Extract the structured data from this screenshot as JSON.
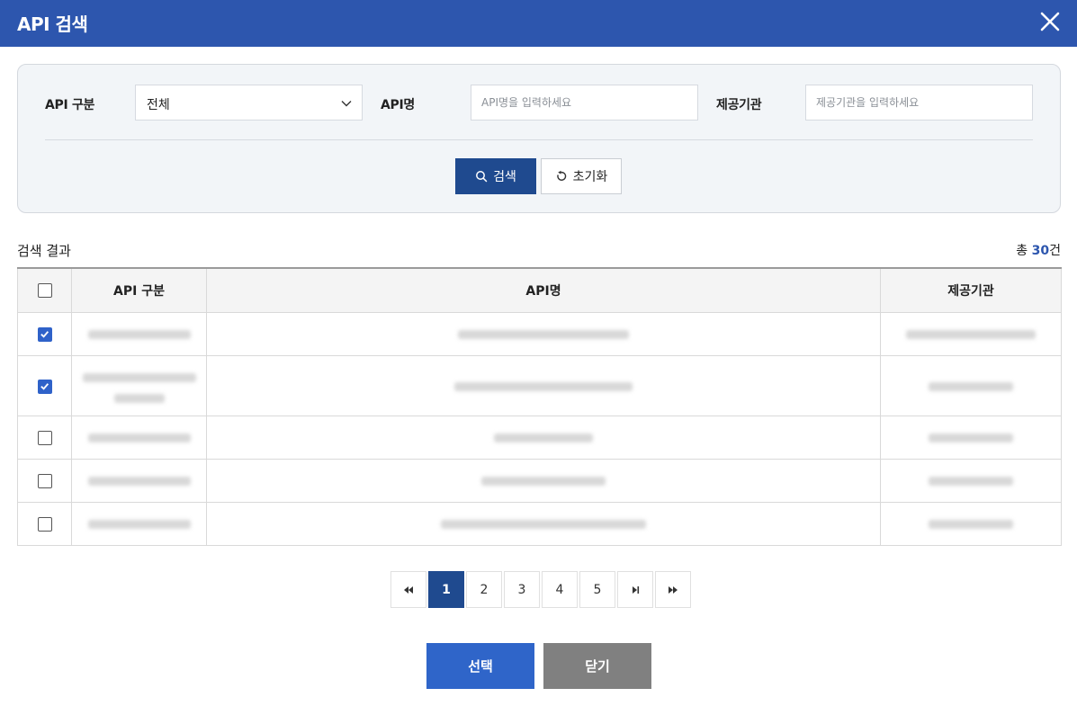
{
  "header": {
    "title": "API 검색"
  },
  "search": {
    "api_type_label": "API 구분",
    "api_type_value": "전체",
    "api_name_label": "API명",
    "api_name_placeholder": "API명을 입력하세요",
    "provider_label": "제공기관",
    "provider_placeholder": "제공기관을 입력하세요",
    "search_button": "검색",
    "reset_button": "초기화"
  },
  "results": {
    "title": "검색 결과",
    "total_prefix": "총 ",
    "total_count": "30",
    "total_suffix": "건",
    "columns": [
      "API 구분",
      "API명",
      "제공기관"
    ],
    "rows": [
      {
        "checked": true
      },
      {
        "checked": true
      },
      {
        "checked": false
      },
      {
        "checked": false
      },
      {
        "checked": false
      }
    ]
  },
  "pagination": {
    "pages": [
      "1",
      "2",
      "3",
      "4",
      "5"
    ],
    "current": "1"
  },
  "footer": {
    "select_button": "선택",
    "close_button": "닫기"
  },
  "colors": {
    "header": "#2d56ae",
    "primary": "#1f4a8f",
    "accent": "#2f65c9",
    "close": "#808080"
  },
  "icons": {
    "close": "close-icon",
    "chevron": "chevron-down-icon",
    "search": "search-icon",
    "reset": "reset-icon",
    "first": "first-page-icon",
    "last": "last-page-icon",
    "next_group": "next-group-icon"
  }
}
